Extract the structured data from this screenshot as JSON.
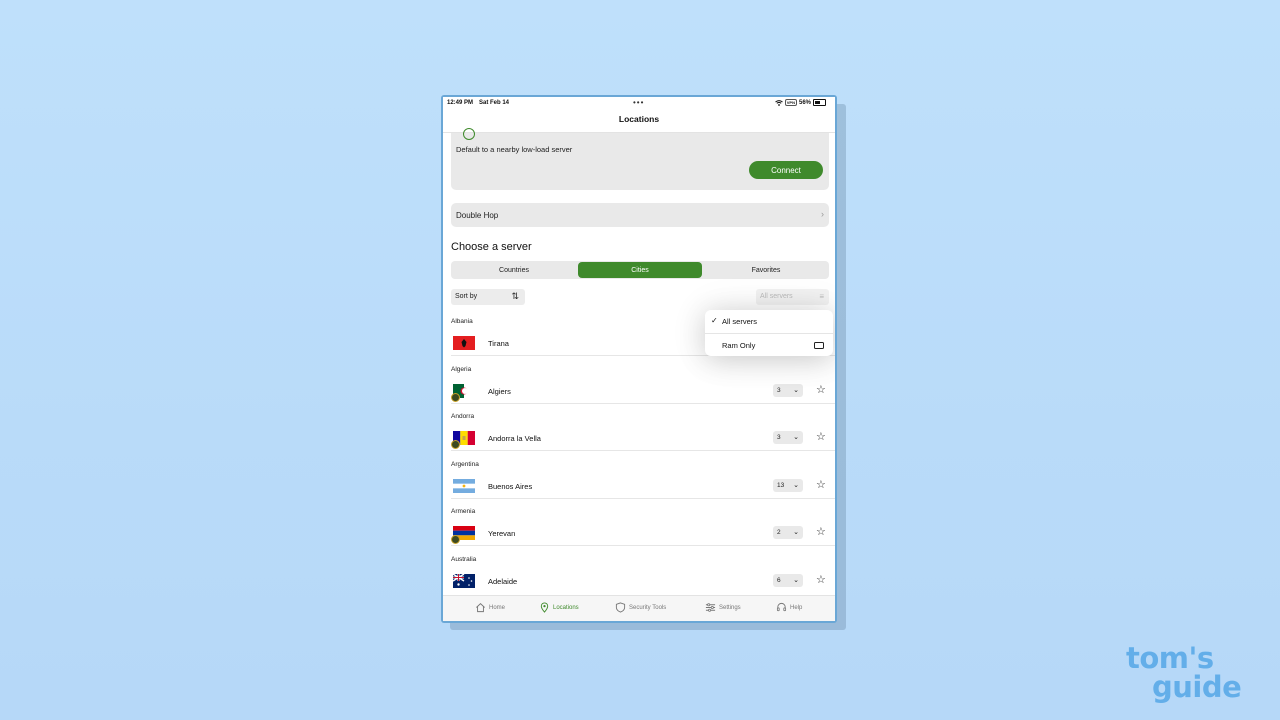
{
  "status_bar": {
    "time": "12:49 PM",
    "date": "Sat Feb 14",
    "battery": "56%"
  },
  "nav": {
    "title": "Locations"
  },
  "quick_connect": {
    "description": "Default to a nearby low-load server",
    "connect_label": "Connect"
  },
  "double_hop": {
    "label": "Double Hop"
  },
  "section": {
    "title": "Choose a server"
  },
  "tabs": [
    {
      "label": "Countries",
      "active": false
    },
    {
      "label": "Cities",
      "active": true
    },
    {
      "label": "Favorites",
      "active": false
    }
  ],
  "sort": {
    "label": "Sort by"
  },
  "filter": {
    "label": "All servers"
  },
  "dropdown": {
    "options": [
      {
        "label": "All servers",
        "checked": true
      },
      {
        "label": "Ram Only",
        "checked": false
      }
    ]
  },
  "locations": [
    {
      "country": "Albania",
      "city": "Tirana",
      "count": ""
    },
    {
      "country": "Algeria",
      "city": "Algiers",
      "count": "3"
    },
    {
      "country": "Andorra",
      "city": "Andorra la Vella",
      "count": "3"
    },
    {
      "country": "Argentina",
      "city": "Buenos Aires",
      "count": "13"
    },
    {
      "country": "Armenia",
      "city": "Yerevan",
      "count": "2"
    },
    {
      "country": "Australia",
      "city": "Adelaide",
      "count": "6"
    }
  ],
  "tabbar": [
    {
      "label": "Home",
      "icon": "home-icon",
      "active": false
    },
    {
      "label": "Locations",
      "icon": "location-pin-icon",
      "active": true
    },
    {
      "label": "Security Tools",
      "icon": "shield-icon",
      "active": false
    },
    {
      "label": "Settings",
      "icon": "sliders-icon",
      "active": false
    },
    {
      "label": "Help",
      "icon": "headset-icon",
      "active": false
    }
  ],
  "colors": {
    "accent": "#3f8a2c",
    "background": "#bfe0fb",
    "logo": "#63aee9"
  },
  "watermark": {
    "line1": "tom's",
    "line2": "guide"
  }
}
